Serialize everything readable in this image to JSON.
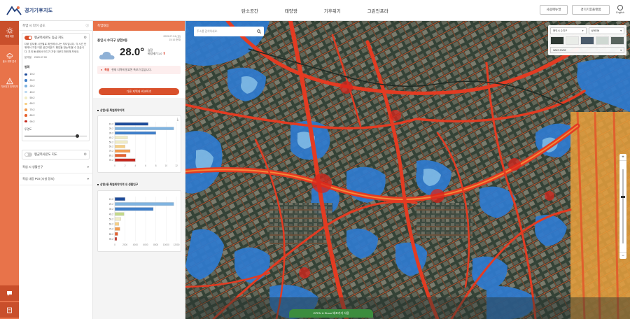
{
  "header": {
    "logo_text": "경기기후지도",
    "nav": [
      "탄소공간",
      "태양광",
      "기후위기",
      "그린인프라"
    ],
    "btn_manual": "사용매뉴얼",
    "btn_climate": "경기기후플랫폼",
    "lang": "English"
  },
  "rail": {
    "items": [
      {
        "label": "폭염 대응",
        "icon": "sun-icon"
      },
      {
        "label": "홍수 취약 분석",
        "icon": "rain-cloud-icon"
      },
      {
        "label": "기후위기 취약지역",
        "icon": "alert-triangle-icon"
      }
    ],
    "bottom_icon": "chat-icon"
  },
  "panel1": {
    "head": "폭염 시 다이 공도",
    "layer1_label": "평균복사온도 등급 지도",
    "desc": "더위 감도를 시간별로 계산해서 나는 지도입니다. 각 시간 단위에서 가장 더운 공간이었고, 행인들 한눈에 볼 수 있습니다. 우리 동네에서 어디가 가장 더운지 확인해 보세요.",
    "sub_label": "분석일",
    "sub_date": "2020.07.00",
    "legend_title": "범례",
    "legend": [
      {
        "label": "19.2",
        "color": "#1e4c9a"
      },
      {
        "label": "29.2",
        "color": "#3f7fc9"
      },
      {
        "label": "39.2",
        "color": "#7fb3e0"
      },
      {
        "label": "49.2",
        "color": "#bcd9ef"
      },
      {
        "label": "59.2",
        "color": "#f0ecc6"
      },
      {
        "label": "69.2",
        "color": "#f7cf83"
      },
      {
        "label": "79.2",
        "color": "#f29b4e"
      },
      {
        "label": "89.2",
        "color": "#e5602d"
      },
      {
        "label": "99.2",
        "color": "#c4291f"
      }
    ],
    "opacity_label": "투명도",
    "opacity_value": 0.85,
    "layer2_label": "평균복사온도 지도",
    "acc1": "폭염 시 생활인구",
    "acc2": "폭염 대응 POI (시설 정보)"
  },
  "panel2": {
    "head": "폭염대응",
    "location": "용인시 수지구 상현2동",
    "date": "2025.07.24 (금)",
    "time": "15:16 현재",
    "temperature": "28.0°",
    "humidity": "습함",
    "wind": "바람세기 1.0",
    "alert_tag": "폭염",
    "alert_text": "현재 지역에 발효된 특보가 없습니다.",
    "compare_btn": "다른 지역과 비교하기",
    "chart1_title": "상현2동 폭염취약지역",
    "chart2_title": "상현2동 폭염취약지역 내 생활인구"
  },
  "map": {
    "search_placeholder": "주소를 검색하세요.",
    "sel_city": "용인시 수지구",
    "sel_dong": "상현2동",
    "view_label": "WMS 20/08",
    "bottom_bar": "OPEN & Share 배포가기 사용"
  },
  "chart_data": [
    {
      "type": "bar",
      "title": "상현2동 폭염취약지역",
      "orientation": "horizontal",
      "categories": [
        "19.2",
        "29.2",
        "39.2",
        "49.2",
        "59.2",
        "69.2",
        "79.2",
        "89.2",
        "99.2"
      ],
      "values": [
        6.5,
        11.5,
        8.0,
        2.5,
        2.5,
        2.0,
        3.0,
        2.2,
        4.0
      ],
      "colors": [
        "#1e4c9a",
        "#7fb3e0",
        "#3f7fc9",
        "#f0ecc6",
        "#f0ecc6",
        "#f7cf83",
        "#f29b4e",
        "#e5602d",
        "#c4291f"
      ],
      "xticks": [
        0,
        2,
        4,
        6,
        8,
        10,
        12
      ],
      "xlim": [
        0,
        12
      ]
    },
    {
      "type": "bar",
      "title": "상현2동 폭염취약지역 내 생활인구",
      "orientation": "horizontal",
      "categories": [
        "19.2",
        "29.2",
        "39.2",
        "49.2",
        "59.2",
        "69.2",
        "79.2",
        "89.2",
        "99.2"
      ],
      "values": [
        2000,
        11500,
        7500,
        1800,
        1200,
        800,
        1000,
        600,
        400
      ],
      "colors": [
        "#1e4c9a",
        "#7fb3e0",
        "#3f7fc9",
        "#c3d98a",
        "#f0ecc6",
        "#f7cf83",
        "#f29b4e",
        "#e5602d",
        "#c4291f"
      ],
      "xticks": [
        0,
        2000,
        4000,
        6000,
        8000,
        10000,
        12000
      ],
      "xlim": [
        0,
        12000
      ]
    }
  ]
}
